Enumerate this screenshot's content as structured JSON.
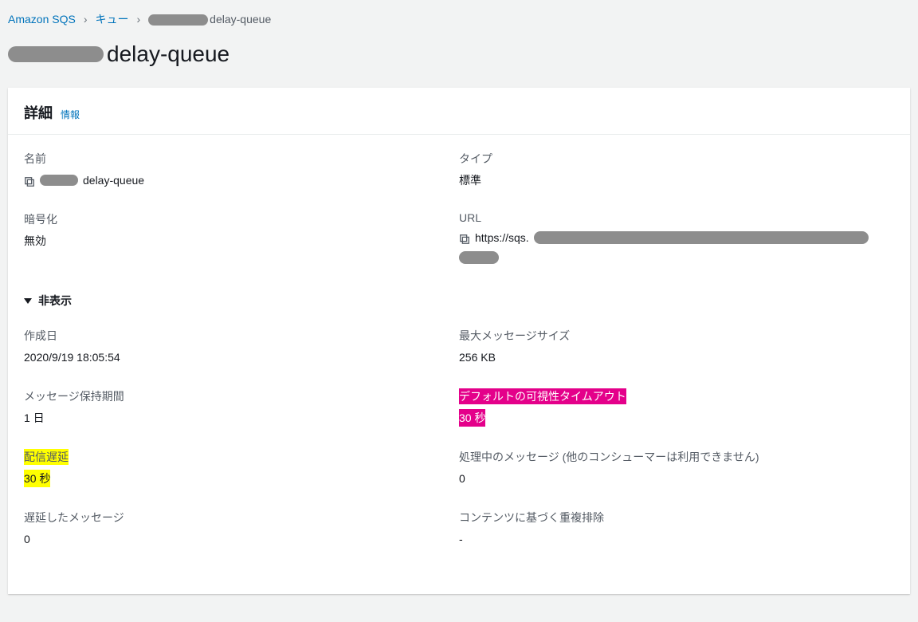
{
  "breadcrumb": {
    "root": "Amazon SQS",
    "level1": "キュー",
    "current_suffix": "delay-queue"
  },
  "page": {
    "title_suffix": "delay-queue"
  },
  "panel": {
    "heading": "詳細",
    "info": "情報",
    "collapse_label": "非表示"
  },
  "fields": {
    "name": {
      "label": "名前",
      "value_suffix": "delay-queue"
    },
    "type": {
      "label": "タイプ",
      "value": "標準"
    },
    "encryption": {
      "label": "暗号化",
      "value": "無効"
    },
    "url": {
      "label": "URL",
      "value_prefix": "https://sqs."
    },
    "created": {
      "label": "作成日",
      "value": "2020/9/19 18:05:54"
    },
    "max_size": {
      "label": "最大メッセージサイズ",
      "value": "256 KB"
    },
    "retention": {
      "label": "メッセージ保持期間",
      "value": "1 日"
    },
    "visibility": {
      "label": "デフォルトの可視性タイムアウト",
      "value": "30 秒"
    },
    "delivery_delay": {
      "label": "配信遅延",
      "value": "30 秒"
    },
    "in_flight": {
      "label": "処理中のメッセージ (他のコンシューマーは利用できません)",
      "value": "0"
    },
    "delayed": {
      "label": "遅延したメッセージ",
      "value": "0"
    },
    "content_dedup": {
      "label": "コンテンツに基づく重複排除",
      "value": "-"
    }
  }
}
